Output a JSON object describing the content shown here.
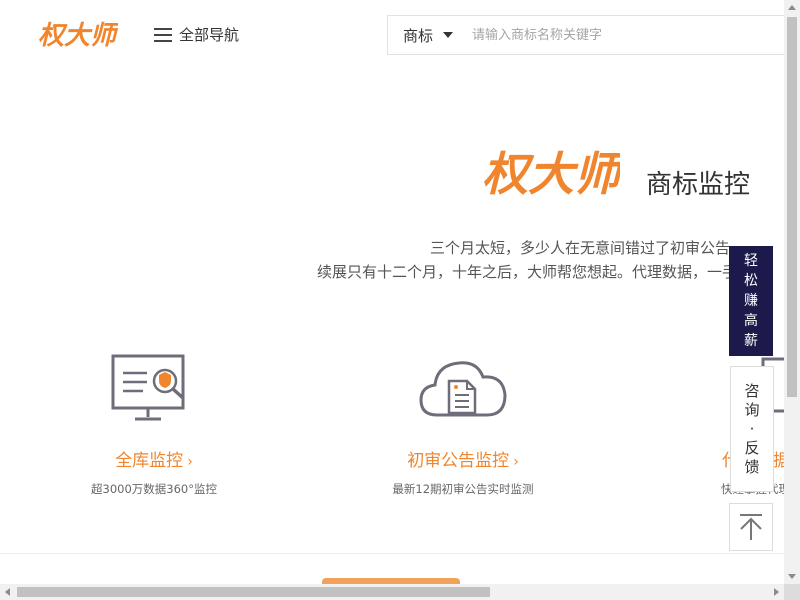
{
  "header": {
    "logo_text": "权大师",
    "nav_label": "全部导航",
    "search": {
      "type_label": "商标",
      "placeholder": "请输入商标名称关键字"
    }
  },
  "hero": {
    "logo_text": "权大师",
    "title": "商标监控",
    "line1": "三个月太短，多少人在无意间错过了初审公告。",
    "line2": "续展只有十二个月，十年之后，大师帮您想起。代理数据，一手掌握。"
  },
  "features": [
    {
      "title": "全库监控",
      "subtitle": "超3000万数据360°监控",
      "icon": "monitor-shield-icon"
    },
    {
      "title": "初审公告监控",
      "subtitle": "最新12期初审公告实时监测",
      "icon": "cloud-document-icon"
    },
    {
      "title": "代理数据",
      "subtitle": "快速掌握代理机构数据",
      "icon": "data-icon"
    }
  ],
  "float": {
    "earn": [
      "轻",
      "松",
      "赚",
      "高",
      "薪"
    ],
    "consult": [
      "咨",
      "询",
      "·",
      "反",
      "馈"
    ],
    "back_to_top_icon": "arrow-up-icon"
  },
  "colors": {
    "brand_orange": "#f0852d",
    "navy": "#1c1a4a"
  }
}
